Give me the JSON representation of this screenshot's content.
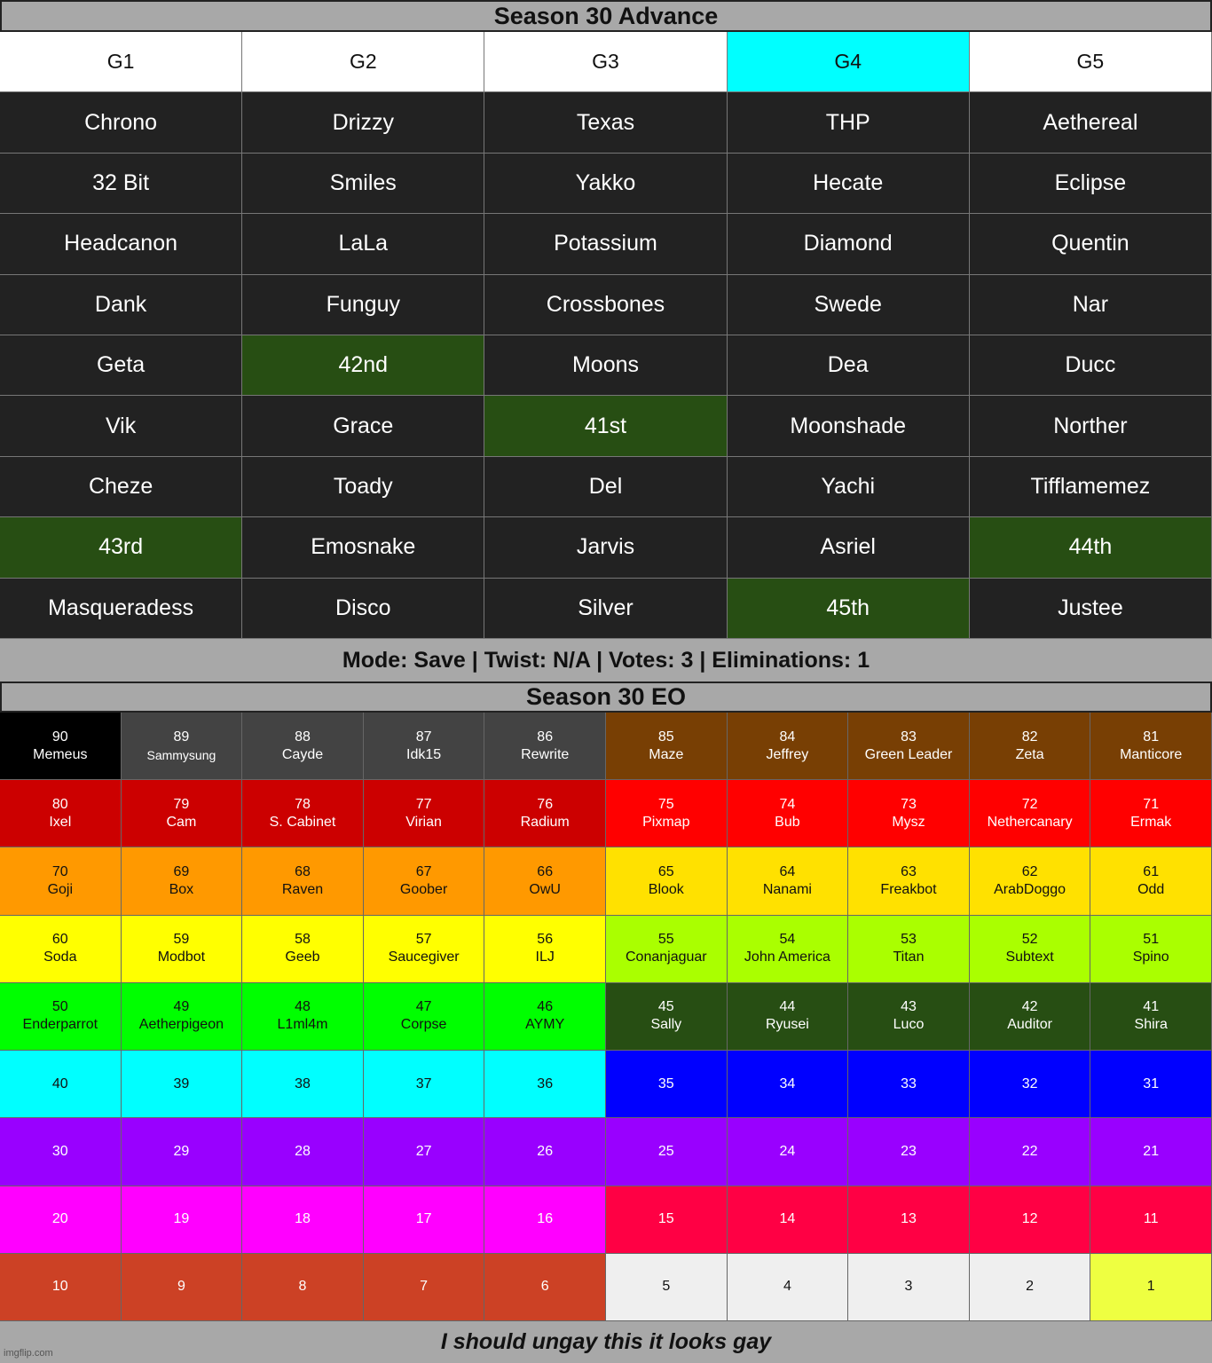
{
  "advance": {
    "title": "Season 30 Advance",
    "headers": [
      {
        "label": "G1",
        "bg": "#ffffff",
        "fg": "#111111"
      },
      {
        "label": "G2",
        "bg": "#ffffff",
        "fg": "#111111"
      },
      {
        "label": "G3",
        "bg": "#ffffff",
        "fg": "#111111"
      },
      {
        "label": "G4",
        "bg": "#00ffff",
        "fg": "#111111"
      },
      {
        "label": "G5",
        "bg": "#ffffff",
        "fg": "#111111"
      }
    ],
    "default_bg": "#222222",
    "highlight_bg": "#274e13",
    "rows": [
      [
        {
          "name": "Chrono"
        },
        {
          "name": "Drizzy"
        },
        {
          "name": "Texas"
        },
        {
          "name": "THP"
        },
        {
          "name": "Aethereal"
        }
      ],
      [
        {
          "name": "32 Bit"
        },
        {
          "name": "Smiles"
        },
        {
          "name": "Yakko"
        },
        {
          "name": "Hecate"
        },
        {
          "name": "Eclipse"
        }
      ],
      [
        {
          "name": "Headcanon"
        },
        {
          "name": "LaLa"
        },
        {
          "name": "Potassium"
        },
        {
          "name": "Diamond"
        },
        {
          "name": "Quentin"
        }
      ],
      [
        {
          "name": "Dank"
        },
        {
          "name": "Funguy"
        },
        {
          "name": "Crossbones"
        },
        {
          "name": "Swede"
        },
        {
          "name": "Nar"
        }
      ],
      [
        {
          "name": "Geta"
        },
        {
          "name": "42nd",
          "highlight": true
        },
        {
          "name": "Moons"
        },
        {
          "name": "Dea"
        },
        {
          "name": "Ducc"
        }
      ],
      [
        {
          "name": "Vik"
        },
        {
          "name": "Grace"
        },
        {
          "name": "41st",
          "highlight": true
        },
        {
          "name": "Moonshade"
        },
        {
          "name": "Norther"
        }
      ],
      [
        {
          "name": "Cheze"
        },
        {
          "name": "Toady"
        },
        {
          "name": "Del"
        },
        {
          "name": "Yachi"
        },
        {
          "name": "Tifflamemez"
        }
      ],
      [
        {
          "name": "43rd",
          "highlight": true
        },
        {
          "name": "Emosnake"
        },
        {
          "name": "Jarvis"
        },
        {
          "name": "Asriel"
        },
        {
          "name": "44th",
          "highlight": true
        }
      ],
      [
        {
          "name": "Masqueradess"
        },
        {
          "name": "Disco"
        },
        {
          "name": "Silver"
        },
        {
          "name": "45th",
          "highlight": true
        },
        {
          "name": "Justee"
        }
      ]
    ],
    "mode_line": "Mode: Save | Twist: N/A | Votes: 3 | Eliminations: 1"
  },
  "eo": {
    "title": "Season 30 EO",
    "rows": [
      [
        {
          "num": "90",
          "name": "Memeus",
          "bg": "#000000",
          "fg": "#ffffff"
        },
        {
          "num": "89",
          "name": "Sammysung",
          "bg": "#434343",
          "fg": "#ffffff",
          "small": true
        },
        {
          "num": "88",
          "name": "Cayde",
          "bg": "#434343",
          "fg": "#ffffff"
        },
        {
          "num": "87",
          "name": "Idk15",
          "bg": "#434343",
          "fg": "#ffffff"
        },
        {
          "num": "86",
          "name": "Rewrite",
          "bg": "#434343",
          "fg": "#ffffff"
        },
        {
          "num": "85",
          "name": "Maze",
          "bg": "#783f04",
          "fg": "#ffffff"
        },
        {
          "num": "84",
          "name": "Jeffrey",
          "bg": "#783f04",
          "fg": "#ffffff"
        },
        {
          "num": "83",
          "name": "Green Leader",
          "bg": "#783f04",
          "fg": "#ffffff"
        },
        {
          "num": "82",
          "name": "Zeta",
          "bg": "#783f04",
          "fg": "#ffffff"
        },
        {
          "num": "81",
          "name": "Manticore",
          "bg": "#783f04",
          "fg": "#ffffff"
        }
      ],
      [
        {
          "num": "80",
          "name": "Ixel",
          "bg": "#cc0000",
          "fg": "#ffffff"
        },
        {
          "num": "79",
          "name": "Cam",
          "bg": "#cc0000",
          "fg": "#ffffff"
        },
        {
          "num": "78",
          "name": "S. Cabinet",
          "bg": "#cc0000",
          "fg": "#ffffff"
        },
        {
          "num": "77",
          "name": "Virian",
          "bg": "#cc0000",
          "fg": "#ffffff"
        },
        {
          "num": "76",
          "name": "Radium",
          "bg": "#cc0000",
          "fg": "#ffffff"
        },
        {
          "num": "75",
          "name": "Pixmap",
          "bg": "#ff0000",
          "fg": "#ffffff"
        },
        {
          "num": "74",
          "name": "Bub",
          "bg": "#ff0000",
          "fg": "#ffffff"
        },
        {
          "num": "73",
          "name": "Mysz",
          "bg": "#ff0000",
          "fg": "#ffffff"
        },
        {
          "num": "72",
          "name": "Nethercanary",
          "bg": "#ff0000",
          "fg": "#ffffff"
        },
        {
          "num": "71",
          "name": "Ermak",
          "bg": "#ff0000",
          "fg": "#ffffff"
        }
      ],
      [
        {
          "num": "70",
          "name": "Goji",
          "bg": "#ff9900",
          "fg": "#111111"
        },
        {
          "num": "69",
          "name": "Box",
          "bg": "#ff9900",
          "fg": "#111111"
        },
        {
          "num": "68",
          "name": "Raven",
          "bg": "#ff9900",
          "fg": "#111111"
        },
        {
          "num": "67",
          "name": "Goober",
          "bg": "#ff9900",
          "fg": "#111111"
        },
        {
          "num": "66",
          "name": "OwU",
          "bg": "#ff9900",
          "fg": "#111111"
        },
        {
          "num": "65",
          "name": "Blook",
          "bg": "#ffe100",
          "fg": "#111111"
        },
        {
          "num": "64",
          "name": "Nanami",
          "bg": "#ffe100",
          "fg": "#111111"
        },
        {
          "num": "63",
          "name": "Freakbot",
          "bg": "#ffe100",
          "fg": "#111111"
        },
        {
          "num": "62",
          "name": "ArabDoggo",
          "bg": "#ffe100",
          "fg": "#111111"
        },
        {
          "num": "61",
          "name": "Odd",
          "bg": "#ffe100",
          "fg": "#111111"
        }
      ],
      [
        {
          "num": "60",
          "name": "Soda",
          "bg": "#ffff00",
          "fg": "#111111"
        },
        {
          "num": "59",
          "name": "Modbot",
          "bg": "#ffff00",
          "fg": "#111111"
        },
        {
          "num": "58",
          "name": "Geeb",
          "bg": "#ffff00",
          "fg": "#111111"
        },
        {
          "num": "57",
          "name": "Saucegiver",
          "bg": "#ffff00",
          "fg": "#111111"
        },
        {
          "num": "56",
          "name": "ILJ",
          "bg": "#ffff00",
          "fg": "#111111"
        },
        {
          "num": "55",
          "name": "Conanjaguar",
          "bg": "#aaff00",
          "fg": "#111111"
        },
        {
          "num": "54",
          "name": "John America",
          "bg": "#aaff00",
          "fg": "#111111"
        },
        {
          "num": "53",
          "name": "Titan",
          "bg": "#aaff00",
          "fg": "#111111"
        },
        {
          "num": "52",
          "name": "Subtext",
          "bg": "#aaff00",
          "fg": "#111111"
        },
        {
          "num": "51",
          "name": "Spino",
          "bg": "#aaff00",
          "fg": "#111111"
        }
      ],
      [
        {
          "num": "50",
          "name": "Enderparrot",
          "bg": "#00ff00",
          "fg": "#111111"
        },
        {
          "num": "49",
          "name": "Aetherpigeon",
          "bg": "#00ff00",
          "fg": "#111111"
        },
        {
          "num": "48",
          "name": "L1ml4m",
          "bg": "#00ff00",
          "fg": "#111111"
        },
        {
          "num": "47",
          "name": "Corpse",
          "bg": "#00ff00",
          "fg": "#111111"
        },
        {
          "num": "46",
          "name": "AYMY",
          "bg": "#00ff00",
          "fg": "#111111"
        },
        {
          "num": "45",
          "name": "Sally",
          "bg": "#274e13",
          "fg": "#ffffff"
        },
        {
          "num": "44",
          "name": "Ryusei",
          "bg": "#274e13",
          "fg": "#ffffff"
        },
        {
          "num": "43",
          "name": "Luco",
          "bg": "#274e13",
          "fg": "#ffffff"
        },
        {
          "num": "42",
          "name": "Auditor",
          "bg": "#274e13",
          "fg": "#ffffff"
        },
        {
          "num": "41",
          "name": "Shira",
          "bg": "#274e13",
          "fg": "#ffffff"
        }
      ],
      [
        {
          "num": "40",
          "name": "",
          "bg": "#00ffff",
          "fg": "#111111"
        },
        {
          "num": "39",
          "name": "",
          "bg": "#00ffff",
          "fg": "#111111"
        },
        {
          "num": "38",
          "name": "",
          "bg": "#00ffff",
          "fg": "#111111"
        },
        {
          "num": "37",
          "name": "",
          "bg": "#00ffff",
          "fg": "#111111"
        },
        {
          "num": "36",
          "name": "",
          "bg": "#00ffff",
          "fg": "#111111"
        },
        {
          "num": "35",
          "name": "",
          "bg": "#0000ff",
          "fg": "#ffffff"
        },
        {
          "num": "34",
          "name": "",
          "bg": "#0000ff",
          "fg": "#ffffff"
        },
        {
          "num": "33",
          "name": "",
          "bg": "#0000ff",
          "fg": "#ffffff"
        },
        {
          "num": "32",
          "name": "",
          "bg": "#0000ff",
          "fg": "#ffffff"
        },
        {
          "num": "31",
          "name": "",
          "bg": "#0000ff",
          "fg": "#ffffff"
        }
      ],
      [
        {
          "num": "30",
          "name": "",
          "bg": "#9900ff",
          "fg": "#ffffff"
        },
        {
          "num": "29",
          "name": "",
          "bg": "#9900ff",
          "fg": "#ffffff"
        },
        {
          "num": "28",
          "name": "",
          "bg": "#9900ff",
          "fg": "#ffffff"
        },
        {
          "num": "27",
          "name": "",
          "bg": "#9900ff",
          "fg": "#ffffff"
        },
        {
          "num": "26",
          "name": "",
          "bg": "#9900ff",
          "fg": "#ffffff"
        },
        {
          "num": "25",
          "name": "",
          "bg": "#9900ff",
          "fg": "#ffffff"
        },
        {
          "num": "24",
          "name": "",
          "bg": "#9900ff",
          "fg": "#ffffff"
        },
        {
          "num": "23",
          "name": "",
          "bg": "#9900ff",
          "fg": "#ffffff"
        },
        {
          "num": "22",
          "name": "",
          "bg": "#9900ff",
          "fg": "#ffffff"
        },
        {
          "num": "21",
          "name": "",
          "bg": "#9900ff",
          "fg": "#ffffff"
        }
      ],
      [
        {
          "num": "20",
          "name": "",
          "bg": "#ff00ff",
          "fg": "#ffffff"
        },
        {
          "num": "19",
          "name": "",
          "bg": "#ff00ff",
          "fg": "#ffffff"
        },
        {
          "num": "18",
          "name": "",
          "bg": "#ff00ff",
          "fg": "#ffffff"
        },
        {
          "num": "17",
          "name": "",
          "bg": "#ff00ff",
          "fg": "#ffffff"
        },
        {
          "num": "16",
          "name": "",
          "bg": "#ff00ff",
          "fg": "#ffffff"
        },
        {
          "num": "15",
          "name": "",
          "bg": "#ff0044",
          "fg": "#ffffff"
        },
        {
          "num": "14",
          "name": "",
          "bg": "#ff0044",
          "fg": "#ffffff"
        },
        {
          "num": "13",
          "name": "",
          "bg": "#ff0044",
          "fg": "#ffffff"
        },
        {
          "num": "12",
          "name": "",
          "bg": "#ff0044",
          "fg": "#ffffff"
        },
        {
          "num": "11",
          "name": "",
          "bg": "#ff0044",
          "fg": "#ffffff"
        }
      ],
      [
        {
          "num": "10",
          "name": "",
          "bg": "#cc4125",
          "fg": "#ffffff"
        },
        {
          "num": "9",
          "name": "",
          "bg": "#cc4125",
          "fg": "#ffffff"
        },
        {
          "num": "8",
          "name": "",
          "bg": "#cc4125",
          "fg": "#ffffff"
        },
        {
          "num": "7",
          "name": "",
          "bg": "#cc4125",
          "fg": "#ffffff"
        },
        {
          "num": "6",
          "name": "",
          "bg": "#cc4125",
          "fg": "#ffffff"
        },
        {
          "num": "5",
          "name": "",
          "bg": "#efefef",
          "fg": "#111111"
        },
        {
          "num": "4",
          "name": "",
          "bg": "#efefef",
          "fg": "#111111"
        },
        {
          "num": "3",
          "name": "",
          "bg": "#efefef",
          "fg": "#111111"
        },
        {
          "num": "2",
          "name": "",
          "bg": "#efefef",
          "fg": "#111111"
        },
        {
          "num": "1",
          "name": "",
          "bg": "#eeff41",
          "fg": "#111111"
        }
      ]
    ]
  },
  "footer": {
    "caption": "I should ungay this it looks gay",
    "watermark": "imgflip.com"
  }
}
